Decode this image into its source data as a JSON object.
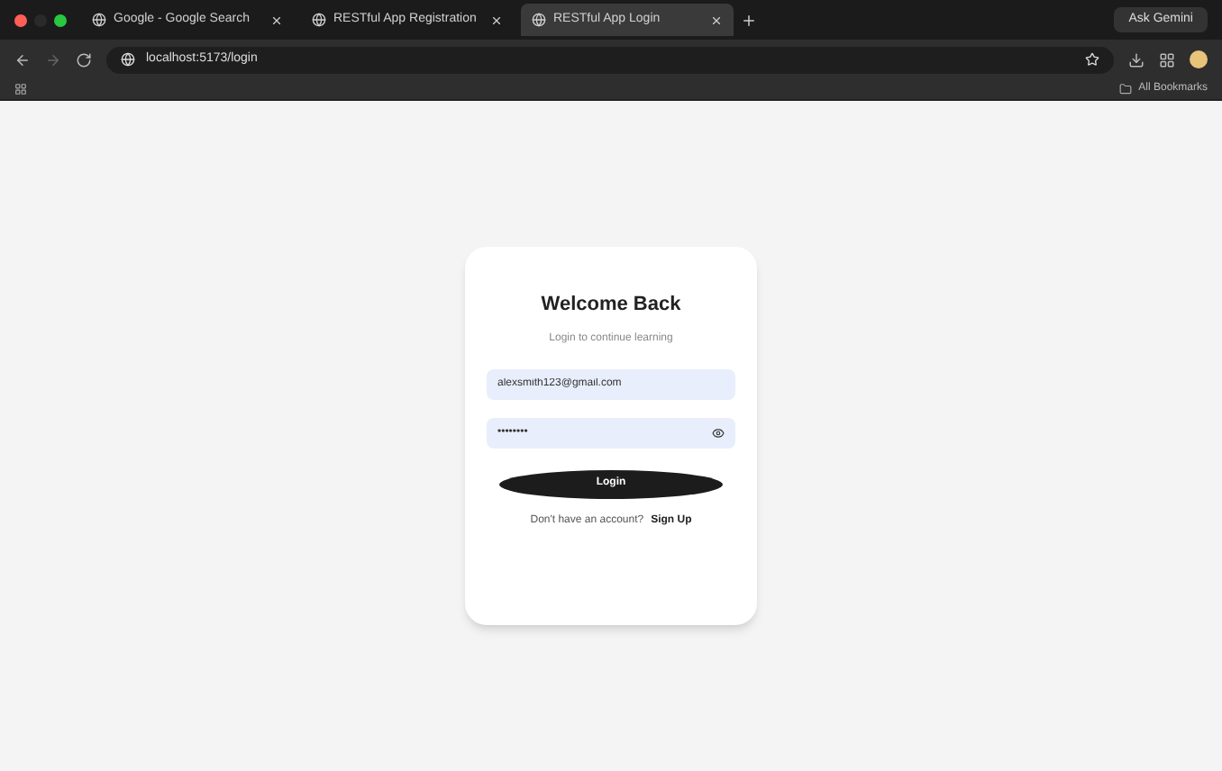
{
  "browser": {
    "tabs": [
      {
        "title": "Google - Google Search",
        "selected": false
      },
      {
        "title": "RESTful App Registration",
        "selected": false
      },
      {
        "title": "RESTful App Login",
        "selected": true
      }
    ],
    "top_button": "Ask Gemini",
    "address": "localhost:5173/login",
    "bookmarks_label": "All Bookmarks"
  },
  "login": {
    "title": "Welcome Back",
    "subtitle": "Login to continue learning",
    "email": {
      "value": "alexsmith123@gmail.com"
    },
    "password": {
      "value": "••••••••"
    },
    "button": "Login",
    "footer_text": "Don't have an account?",
    "footer_link": "Sign Up"
  }
}
